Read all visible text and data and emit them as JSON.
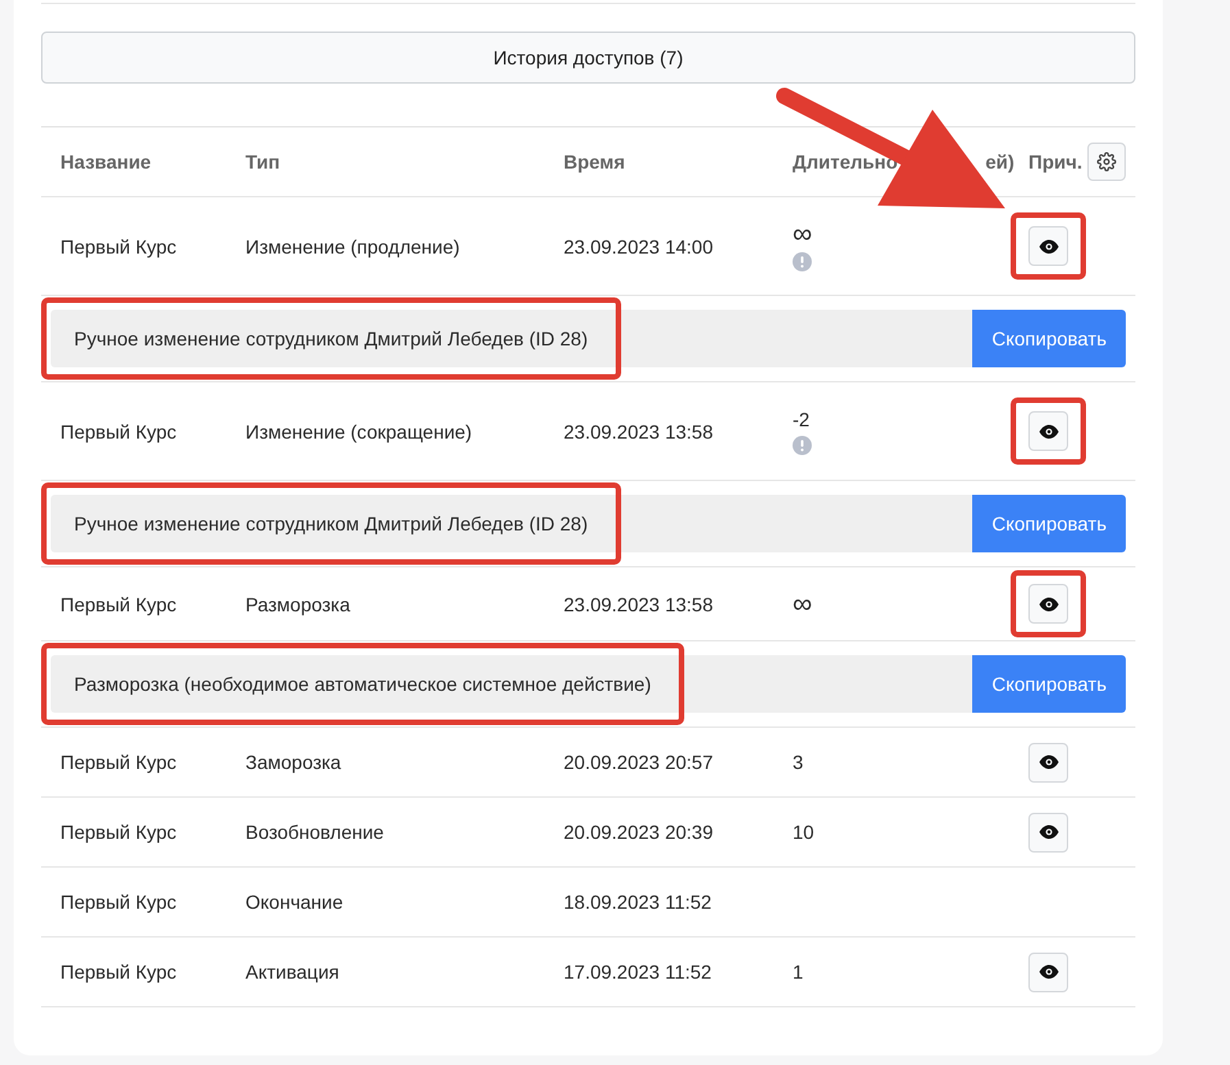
{
  "history_button": "История доступов (7)",
  "table": {
    "columns": [
      {
        "label": "Название"
      },
      {
        "label": "Тип"
      },
      {
        "label": "Время"
      },
      {
        "label": "Длительно",
        "label_tail": "ей)"
      },
      {
        "label": "Прич."
      }
    ],
    "rows": [
      {
        "name": "Первый Курс",
        "type": "Изменение (продление)",
        "time": "23.09.2023 14:00",
        "duration": "∞",
        "has_note": true,
        "has_reason_button": true,
        "highlighted": true,
        "reason": {
          "text": "Ручное изменение сотрудником Дмитрий Лебедев (ID 28)",
          "copy": "Скопировать",
          "highlighted": true
        }
      },
      {
        "name": "Первый Курс",
        "type": "Изменение (сокращение)",
        "time": "23.09.2023 13:58",
        "duration": "-2",
        "has_note": true,
        "has_reason_button": true,
        "highlighted": true,
        "reason": {
          "text": "Ручное изменение сотрудником Дмитрий Лебедев (ID 28)",
          "copy": "Скопировать",
          "highlighted": true
        }
      },
      {
        "name": "Первый Курс",
        "type": "Разморозка",
        "time": "23.09.2023 13:58",
        "duration": "∞",
        "has_note": false,
        "has_reason_button": true,
        "highlighted": true,
        "reason": {
          "text": "Разморозка (необходимое автоматическое системное действие)",
          "copy": "Скопировать",
          "highlighted": true
        }
      },
      {
        "name": "Первый Курс",
        "type": "Заморозка",
        "time": "20.09.2023 20:57",
        "duration": "3",
        "has_note": false,
        "has_reason_button": true,
        "highlighted": false
      },
      {
        "name": "Первый Курс",
        "type": "Возобновление",
        "time": "20.09.2023 20:39",
        "duration": "10",
        "has_note": false,
        "has_reason_button": true,
        "highlighted": false
      },
      {
        "name": "Первый Курс",
        "type": "Окончание",
        "time": "18.09.2023 11:52",
        "has_note": false,
        "has_reason_button": false,
        "highlighted": false
      },
      {
        "name": "Первый Курс",
        "type": "Активация",
        "time": "17.09.2023 11:52",
        "duration": "1",
        "has_note": false,
        "has_reason_button": true,
        "highlighted": false
      }
    ]
  }
}
